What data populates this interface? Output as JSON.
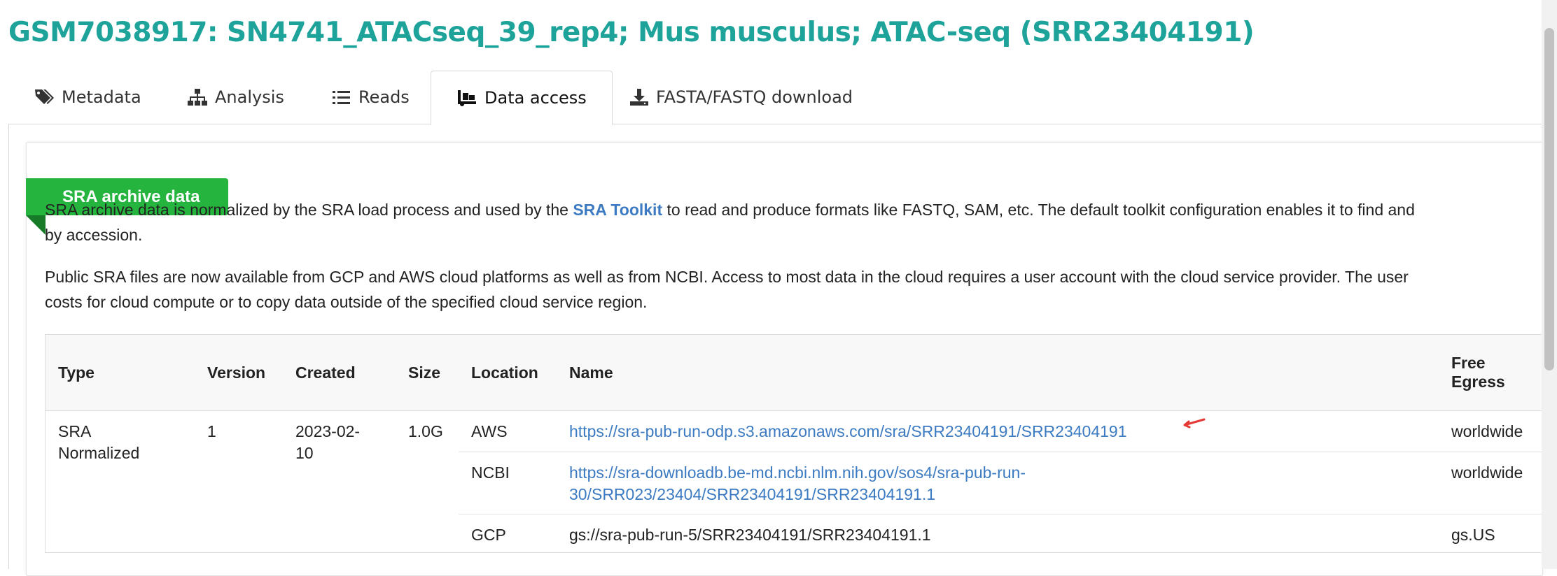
{
  "page": {
    "title": "GSM7038917: SN4741_ATACseq_39_rep4; Mus musculus; ATAC-seq (SRR23404191)"
  },
  "tabs": [
    {
      "label": "Metadata",
      "icon": "tags-icon"
    },
    {
      "label": "Analysis",
      "icon": "sitemap-icon"
    },
    {
      "label": "Reads",
      "icon": "list-icon"
    },
    {
      "label": "Data access",
      "icon": "dolly-icon",
      "active": true
    },
    {
      "label": "FASTA/FASTQ download",
      "icon": "download-icon"
    }
  ],
  "panel": {
    "ribbon": "SRA archive data",
    "para1_before": "SRA archive data is normalized by the SRA load process and used by the ",
    "para1_link": "SRA Toolkit",
    "para1_after": " to read and produce formats like FASTQ, SAM, etc. The default toolkit configuration enables it to find and",
    "para1_line2": "by accession.",
    "para2_line1": "Public SRA files are now available from GCP and AWS cloud platforms as well as from NCBI. Access to most data in the cloud requires a user account with the cloud service provider. The user",
    "para2_line2": "costs for cloud compute or to copy data outside of the specified cloud service region."
  },
  "table": {
    "headers": {
      "type": "Type",
      "version": "Version",
      "created": "Created",
      "size": "Size",
      "location": "Location",
      "name": "Name",
      "egress_1": "Free",
      "egress_2": "Egress"
    },
    "type_1": "SRA",
    "type_2": "Normalized",
    "version": "1",
    "created_1": "2023-02-",
    "created_2": "10",
    "size": "1.0G",
    "rows": [
      {
        "location": "AWS",
        "name": "https://sra-pub-run-odp.s3.amazonaws.com/sra/SRR23404191/SRR23404191",
        "egress": "worldwide"
      },
      {
        "location": "NCBI",
        "name_1": "https://sra-downloadb.be-md.ncbi.nlm.nih.gov/sos4/sra-pub-run-",
        "name_2": "30/SRR023/23404/SRR23404191/SRR23404191.1",
        "egress": "worldwide"
      },
      {
        "location": "GCP",
        "name": "gs://sra-pub-run-5/SRR23404191/SRR23404191.1",
        "egress": "gs.US"
      }
    ]
  },
  "colors": {
    "title": "#1da39a",
    "ribbon": "#25b53e",
    "link": "#3c7bc2",
    "annotation_arrow": "#e53935"
  }
}
